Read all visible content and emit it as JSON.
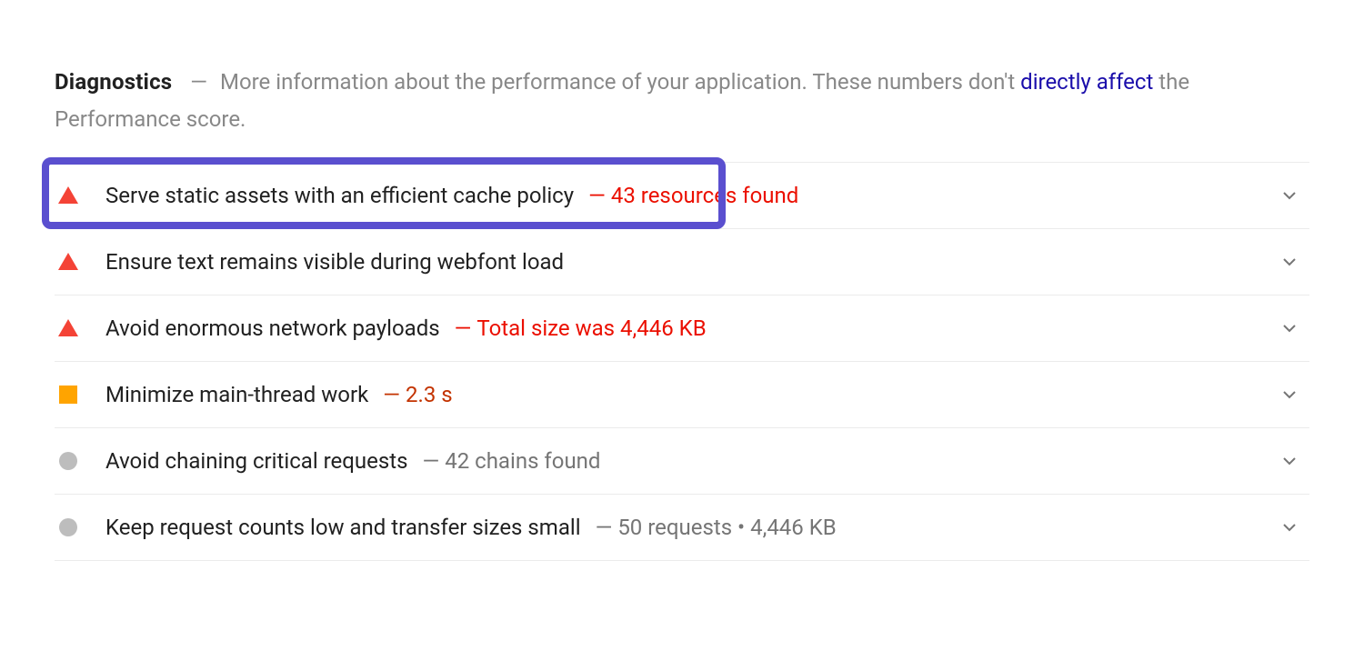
{
  "header": {
    "title": "Diagnostics",
    "desc_before_link": "More information about the performance of your application. These numbers don't ",
    "link_text": "directly affect",
    "desc_after_link": " the Performance score.",
    "dash": "—"
  },
  "audits": [
    {
      "status": "fail",
      "title": "Serve static assets with an efficient cache policy",
      "detail": "43 resources found",
      "detail_color": "red",
      "highlighted": true
    },
    {
      "status": "fail",
      "title": "Ensure text remains visible during webfont load",
      "detail": "",
      "detail_color": "",
      "highlighted": false
    },
    {
      "status": "fail",
      "title": "Avoid enormous network payloads",
      "detail": "Total size was 4,446 KB",
      "detail_color": "red",
      "highlighted": false
    },
    {
      "status": "average",
      "title": "Minimize main-thread work",
      "detail": "2.3 s",
      "detail_color": "orange",
      "highlighted": false
    },
    {
      "status": "info",
      "title": "Avoid chaining critical requests",
      "detail": "42 chains found",
      "detail_color": "gray",
      "highlighted": false
    },
    {
      "status": "info",
      "title": "Keep request counts low and transfer sizes small",
      "detail": "50 requests • 4,446 KB",
      "detail_color": "gray",
      "highlighted": false
    }
  ],
  "dash": "—"
}
